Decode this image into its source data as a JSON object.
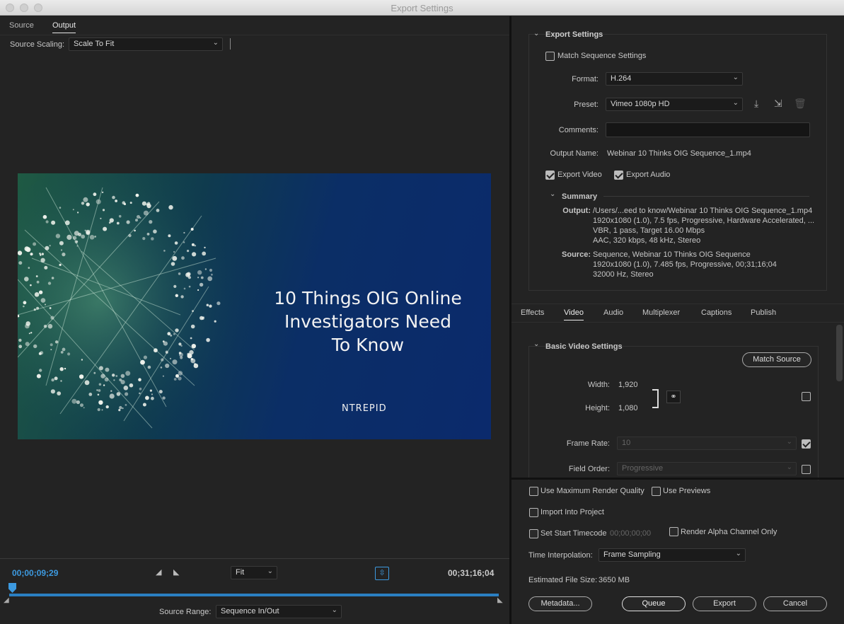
{
  "window": {
    "title": "Export Settings"
  },
  "left": {
    "tabs": [
      "Source",
      "Output"
    ],
    "scaling_label": "Source Scaling:",
    "scaling_value": "Scale To Fit",
    "preview": {
      "title_lines": [
        "10 Things OIG Online",
        "Investigators Need",
        "To Know"
      ],
      "logo": "NTREPID"
    },
    "timecode_current": "00;00;09;29",
    "timecode_duration": "00;31;16;04",
    "zoom_value": "Fit",
    "source_range_label": "Source Range:",
    "source_range_value": "Sequence In/Out"
  },
  "export_settings": {
    "header": "Export Settings",
    "match_sequence": "Match Sequence Settings",
    "format_label": "Format:",
    "format_value": "H.264",
    "preset_label": "Preset:",
    "preset_value": "Vimeo 1080p HD",
    "comments_label": "Comments:",
    "comments_value": "",
    "output_name_label": "Output Name:",
    "output_name_value": "Webinar 10 Thinks OIG Sequence_1.mp4",
    "export_video": "Export Video",
    "export_audio": "Export Audio",
    "summary_header": "Summary",
    "summary_output_label": "Output:",
    "summary_output_lines": [
      "/Users/...eed to know/Webinar 10 Thinks OIG Sequence_1.mp4",
      "1920x1080 (1.0), 7.5 fps, Progressive, Hardware Accelerated, ...",
      "VBR, 1 pass, Target 16.00 Mbps",
      "AAC, 320 kbps, 48 kHz, Stereo"
    ],
    "summary_source_label": "Source:",
    "summary_source_lines": [
      "Sequence, Webinar 10 Thinks OIG Sequence",
      "1920x1080 (1.0), 7.485 fps, Progressive, 00;31;16;04",
      "32000 Hz, Stereo"
    ]
  },
  "tabs": [
    "Effects",
    "Video",
    "Audio",
    "Multiplexer",
    "Captions",
    "Publish"
  ],
  "video": {
    "header": "Basic Video Settings",
    "match_source": "Match Source",
    "width_label": "Width:",
    "width_value": "1,920",
    "height_label": "Height:",
    "height_value": "1,080",
    "frame_rate_label": "Frame Rate:",
    "frame_rate_value": "10",
    "field_order_label": "Field Order:",
    "field_order_value": "Progressive"
  },
  "bottom": {
    "max_render": "Use Maximum Render Quality",
    "use_previews": "Use Previews",
    "import_project": "Import Into Project",
    "start_timecode": "Set Start Timecode",
    "start_timecode_value": "00;00;00;00",
    "render_alpha": "Render Alpha Channel Only",
    "time_interp_label": "Time Interpolation:",
    "time_interp_value": "Frame Sampling",
    "file_size_label": "Estimated File Size:",
    "file_size_value": "3650 MB",
    "metadata": "Metadata...",
    "queue": "Queue",
    "export": "Export",
    "cancel": "Cancel"
  }
}
